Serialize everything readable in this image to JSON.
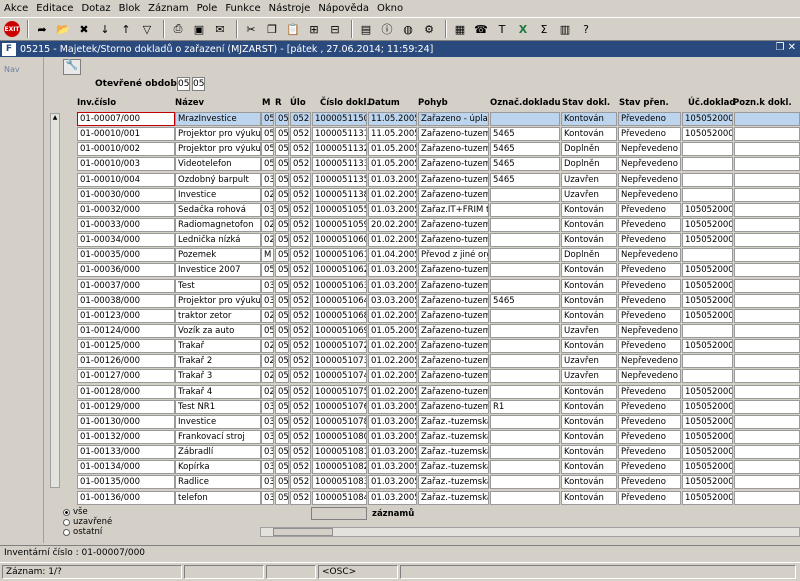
{
  "menu": [
    "Akce",
    "Editace",
    "Dotaz",
    "Blok",
    "Záznam",
    "Pole",
    "Funkce",
    "Nástroje",
    "Nápověda",
    "Okno"
  ],
  "toolbar": {
    "exit_label": "EXIT",
    "icons": [
      "exit-icon",
      "back-icon",
      "open-folder-icon",
      "delete-icon",
      "sort-asc-icon",
      "sort-desc-icon",
      "filter-icon",
      "print-icon",
      "save-icon",
      "mail-icon",
      "cut-icon",
      "copy-icon",
      "paste-icon",
      "insert-icon",
      "delete-row-icon",
      "doc-icon",
      "info-icon",
      "globe-icon",
      "settings-icon",
      "calendar-icon",
      "phone-icon",
      "text-icon",
      "excel-icon",
      "sum-icon",
      "calc-icon",
      "help-icon"
    ]
  },
  "window": {
    "logo": "F",
    "title": "05215 - Majetek/Storno dokladů o zařazení (MJZARST) - [pátek  , 27.06.2014; 11:59:24]",
    "restore_icon": "restore-icon",
    "close_icon": "close-icon"
  },
  "sidebar": {
    "nav_label": "Nav"
  },
  "form": {
    "period_label": "Otevřené období",
    "period_month": "05",
    "period_year": "05",
    "columns": {
      "inv": "Inv.číslo",
      "name": "Název",
      "m": "M",
      "r": "R",
      "ulo": "Úlo",
      "doc": "Číslo dokl.",
      "date": "Datum",
      "move": "Pohyb",
      "mark": "Označ.dokladu",
      "state": "Stav dokl.",
      "transfer": "Stav přen.",
      "acc": "Úč.doklad",
      "note": "Pozn.k dokl."
    },
    "rows": [
      {
        "inv": "01-00007/000",
        "name": "MrazInvestice",
        "m": "05",
        "r": "05",
        "ulo": "052",
        "doc": "1000051150",
        "date": "11.05.2005",
        "move": "Zařazeno - úplatn",
        "mark": "",
        "state": "Kontován",
        "transfer": "Převedeno",
        "acc": "1050520006",
        "note": ""
      },
      {
        "inv": "01-00010/001",
        "name": "Projektor pro výuku",
        "m": "05",
        "r": "05",
        "ulo": "052",
        "doc": "1000051131",
        "date": "11.05.2005",
        "move": "Zařazeno-tuzems",
        "mark": "5465",
        "state": "Kontován",
        "transfer": "Převedeno",
        "acc": "1050520004",
        "note": ""
      },
      {
        "inv": "01-00010/002",
        "name": "Projektor pro výuku",
        "m": "05",
        "r": "05",
        "ulo": "052",
        "doc": "1000051132",
        "date": "01.05.2005",
        "move": "Zařazeno-tuzems",
        "mark": "5465",
        "state": "Doplněn",
        "transfer": "Nepřevedeno",
        "acc": "",
        "note": ""
      },
      {
        "inv": "01-00010/003",
        "name": "Videotelefon",
        "m": "05",
        "r": "05",
        "ulo": "052",
        "doc": "1000051133",
        "date": "01.05.2005",
        "move": "Zařazeno-tuzems",
        "mark": "5465",
        "state": "Doplněn",
        "transfer": "Nepřevedeno",
        "acc": "",
        "note": ""
      },
      {
        "inv": "01-00010/004",
        "name": "Ozdobný barpult",
        "m": "03",
        "r": "05",
        "ulo": "052",
        "doc": "1000051135",
        "date": "01.03.2005",
        "move": "Zařazeno-tuzems",
        "mark": "5465",
        "state": "Uzavřen",
        "transfer": "Nepřevedeno",
        "acc": "",
        "note": ""
      },
      {
        "inv": "01-00030/000",
        "name": "Investice",
        "m": "02",
        "r": "05",
        "ulo": "052",
        "doc": "1000051138",
        "date": "01.02.2005",
        "move": "Zařazeno-tuzems",
        "mark": "",
        "state": "Uzavřen",
        "transfer": "Nepřevedeno",
        "acc": "",
        "note": ""
      },
      {
        "inv": "01-00032/000",
        "name": "Sedačka rohová",
        "m": "03",
        "r": "05",
        "ulo": "052",
        "doc": "1000051055",
        "date": "01.03.2005",
        "move": "Zařaz.IT+FRIM tuz",
        "mark": "",
        "state": "Kontován",
        "transfer": "Převedeno",
        "acc": "1050520004",
        "note": ""
      },
      {
        "inv": "01-00033/000",
        "name": "Radiomagnetofon",
        "m": "02",
        "r": "05",
        "ulo": "052",
        "doc": "1000051059",
        "date": "20.02.2005",
        "move": "Zařazeno-tuzems",
        "mark": "",
        "state": "Kontován",
        "transfer": "Převedeno",
        "acc": "1050520001",
        "note": ""
      },
      {
        "inv": "01-00034/000",
        "name": "Lednička nízká",
        "m": "02",
        "r": "05",
        "ulo": "052",
        "doc": "1000051060",
        "date": "01.02.2005",
        "move": "Zařazeno-tuzems",
        "mark": "",
        "state": "Kontován",
        "transfer": "Převedeno",
        "acc": "1050520001",
        "note": ""
      },
      {
        "inv": "01-00035/000",
        "name": "Pozemek",
        "m": "M",
        "r": "05",
        "ulo": "052",
        "doc": "1000051061",
        "date": "01.04.2005",
        "move": "Převod z jiné orge",
        "mark": "",
        "state": "Doplněn",
        "transfer": "Nepřevedeno",
        "acc": "",
        "note": ""
      },
      {
        "inv": "01-00036/000",
        "name": "Investice 2007",
        "m": "05",
        "r": "05",
        "ulo": "052",
        "doc": "1000051062",
        "date": "01.03.2005",
        "move": "Zařazeno-tuzems",
        "mark": "",
        "state": "Kontován",
        "transfer": "Převedeno",
        "acc": "1050520004",
        "note": ""
      },
      {
        "inv": "01-00037/000",
        "name": "Test",
        "m": "03",
        "r": "05",
        "ulo": "052",
        "doc": "1000051063",
        "date": "01.03.2005",
        "move": "Zařazeno-tuzems",
        "mark": "",
        "state": "Kontován",
        "transfer": "Převedeno",
        "acc": "1050520004",
        "note": ""
      },
      {
        "inv": "01-00038/000",
        "name": "Projektor pro výuku",
        "m": "03",
        "r": "05",
        "ulo": "052",
        "doc": "1000051064",
        "date": "03.03.2005",
        "move": "Zařazeno-tuzems",
        "mark": "5465",
        "state": "Kontován",
        "transfer": "Převedeno",
        "acc": "1050520004",
        "note": ""
      },
      {
        "inv": "01-00123/000",
        "name": "traktor zetor",
        "m": "02",
        "r": "05",
        "ulo": "052",
        "doc": "1000051068",
        "date": "01.02.2005",
        "move": "Zařazeno-tuzems",
        "mark": "",
        "state": "Kontován",
        "transfer": "Převedeno",
        "acc": "1050520001",
        "note": ""
      },
      {
        "inv": "01-00124/000",
        "name": "Vozík za auto",
        "m": "05",
        "r": "05",
        "ulo": "052",
        "doc": "1000051069",
        "date": "01.05.2005",
        "move": "Zařazeno-tuzems",
        "mark": "",
        "state": "Uzavřen",
        "transfer": "Nepřevedeno",
        "acc": "",
        "note": ""
      },
      {
        "inv": "01-00125/000",
        "name": "Trakař",
        "m": "02",
        "r": "05",
        "ulo": "052",
        "doc": "1000051072",
        "date": "01.02.2005",
        "move": "Zařazeno-tuzems",
        "mark": "",
        "state": "Kontován",
        "transfer": "Převedeno",
        "acc": "1050520001",
        "note": ""
      },
      {
        "inv": "01-00126/000",
        "name": "Trakař 2",
        "m": "02",
        "r": "05",
        "ulo": "052",
        "doc": "1000051073",
        "date": "01.02.2005",
        "move": "Zařazeno-tuzems",
        "mark": "",
        "state": "Uzavřen",
        "transfer": "Nepřevedeno",
        "acc": "",
        "note": ""
      },
      {
        "inv": "01-00127/000",
        "name": "Trakař 3",
        "m": "02",
        "r": "05",
        "ulo": "052",
        "doc": "1000051074",
        "date": "01.02.2005",
        "move": "Zařazeno-tuzems",
        "mark": "",
        "state": "Uzavřen",
        "transfer": "Nepřevedeno",
        "acc": "",
        "note": ""
      },
      {
        "inv": "01-00128/000",
        "name": "Trakař 4",
        "m": "02",
        "r": "05",
        "ulo": "052",
        "doc": "1000051075",
        "date": "01.02.2005",
        "move": "Zařazeno-tuzems",
        "mark": "",
        "state": "Kontován",
        "transfer": "Převedeno",
        "acc": "1050520001",
        "note": ""
      },
      {
        "inv": "01-00129/000",
        "name": "Test NR1",
        "m": "03",
        "r": "05",
        "ulo": "052",
        "doc": "1000051076",
        "date": "01.03.2005",
        "move": "Zařazeno-tuzems",
        "mark": "R1",
        "state": "Kontován",
        "transfer": "Převedeno",
        "acc": "1050520005",
        "note": ""
      },
      {
        "inv": "01-00130/000",
        "name": "Investice",
        "m": "03",
        "r": "05",
        "ulo": "052",
        "doc": "1000051078",
        "date": "01.03.2005",
        "move": "Zařaz.-tuzemská",
        "mark": "",
        "state": "Kontován",
        "transfer": "Převedeno",
        "acc": "1050520002",
        "note": ""
      },
      {
        "inv": "01-00132/000",
        "name": "Frankovací stroj",
        "m": "03",
        "r": "05",
        "ulo": "052",
        "doc": "1000051080",
        "date": "01.03.2005",
        "move": "Zařaz.-tuzemská",
        "mark": "",
        "state": "Kontován",
        "transfer": "Převedeno",
        "acc": "1050520005",
        "note": ""
      },
      {
        "inv": "01-00133/000",
        "name": "Zábradlí",
        "m": "03",
        "r": "05",
        "ulo": "052",
        "doc": "1000051081",
        "date": "01.03.2005",
        "move": "Zařaz.-tuzemská",
        "mark": "",
        "state": "Kontován",
        "transfer": "Převedeno",
        "acc": "1050520005",
        "note": ""
      },
      {
        "inv": "01-00134/000",
        "name": "Kopírka",
        "m": "03",
        "r": "05",
        "ulo": "052",
        "doc": "1000051082",
        "date": "01.03.2005",
        "move": "Zařaz.-tuzemská",
        "mark": "",
        "state": "Kontován",
        "transfer": "Převedeno",
        "acc": "1050520005",
        "note": ""
      },
      {
        "inv": "01-00135/000",
        "name": "Radlice",
        "m": "03",
        "r": "05",
        "ulo": "052",
        "doc": "1000051083",
        "date": "01.03.2005",
        "move": "Zařaz.-tuzemská",
        "mark": "",
        "state": "Kontován",
        "transfer": "Převedeno",
        "acc": "1050520005",
        "note": ""
      },
      {
        "inv": "01-00136/000",
        "name": "telefon",
        "m": "03",
        "r": "05",
        "ulo": "052",
        "doc": "1000051084",
        "date": "01.03.2005",
        "move": "Zařaz.-tuzemská",
        "mark": "",
        "state": "Kontován",
        "transfer": "Převedeno",
        "acc": "1050520005",
        "note": ""
      }
    ],
    "filter": {
      "options": [
        "vše",
        "uzavřené",
        "ostatní"
      ],
      "selected": "vše"
    },
    "count_label": "záznamů"
  },
  "status": {
    "line1": "Inventární číslo : 01-00007/000",
    "record": "Záznam: 1/?",
    "osc": "<OSC>"
  },
  "colors": {
    "title_bg": "#2a4a7e",
    "selected_row": "#bcd4ee",
    "focus_border": "#c00000"
  }
}
